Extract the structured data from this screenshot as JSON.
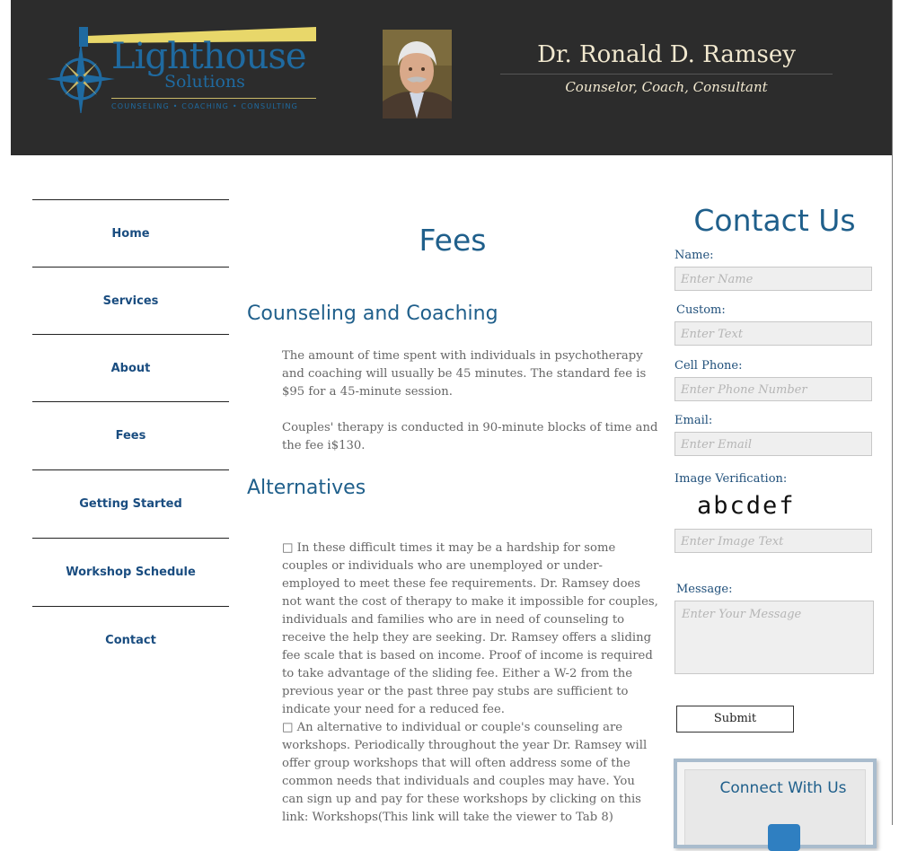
{
  "header": {
    "logo": {
      "word": "Lighthouse",
      "sub": "Solutions",
      "tagline": "COUNSELING • COACHING • CONSULTING"
    },
    "name": "Dr. Ronald D. Ramsey",
    "title": "Counselor, Coach, Consultant"
  },
  "nav": {
    "items": [
      {
        "label": "Home"
      },
      {
        "label": "Services"
      },
      {
        "label": "About"
      },
      {
        "label": "Fees"
      },
      {
        "label": "Getting Started"
      },
      {
        "label": "Workshop Schedule"
      },
      {
        "label": "Contact"
      }
    ]
  },
  "main": {
    "title": "Fees",
    "section1": {
      "heading": "Counseling and Coaching",
      "p1": "The amount of time spent with individuals in psychotherapy and coaching will usually be 45 minutes. The standard fee is $95 for a 45-minute session.",
      "p2": "Couples' therapy is conducted in 90-minute blocks of time and the fee i$130."
    },
    "section2": {
      "heading": "Alternatives",
      "p1": "□ In these difficult times it may be a hardship for some couples or individuals who are unemployed or under-employed to meet these fee requirements.  Dr. Ramsey does not want the cost of therapy to make it impossible for couples, individuals and families who are in need of counseling to receive the help they are seeking.  Dr. Ramsey offers a sliding fee scale that is based on income.  Proof of income is required to take advantage of the sliding fee.  Either a W-2 from the previous year or the past three pay stubs are sufficient to indicate your need for a reduced fee.",
      "p2": "□ An alternative to individual or couple's counseling are workshops.  Periodically throughout the year Dr. Ramsey will offer group workshops that will often address some of the common needs that individuals and couples may have.  You can sign up and pay for these workshops by clicking on this link: Workshops(This link will take the viewer to Tab 8)"
    }
  },
  "contact": {
    "title": "Contact Us",
    "name_label": "Name:",
    "name_placeholder": "Enter Name",
    "custom_label": "Custom:",
    "custom_placeholder": "Enter Text",
    "phone_label": "Cell Phone:",
    "phone_placeholder": "Enter Phone Number",
    "email_label": "Email:",
    "email_placeholder": "Enter Email",
    "verify_label": "Image Verification:",
    "captcha": "abcdef",
    "verify_placeholder": "Enter Image Text",
    "message_label": "Message:",
    "message_placeholder": "Enter Your Message",
    "submit_label": "Submit",
    "connect_title": "Connect With Us"
  }
}
